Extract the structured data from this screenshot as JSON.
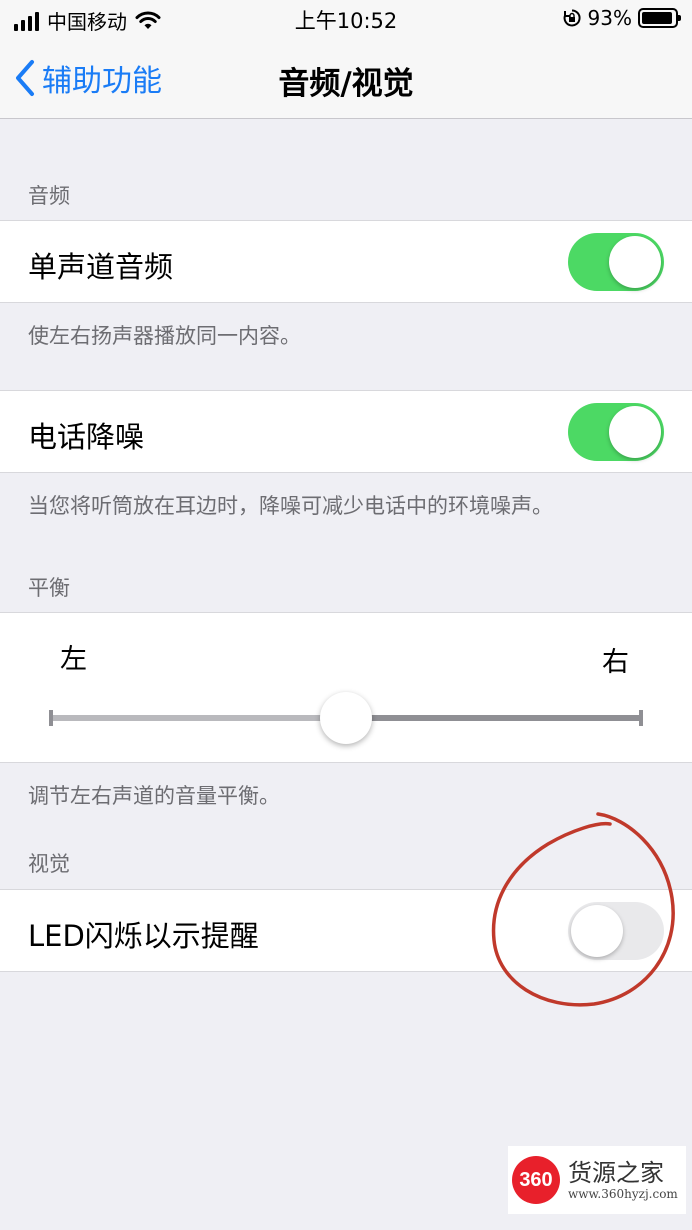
{
  "status_bar": {
    "carrier": "中国移动",
    "time": "上午10:52",
    "battery_percent_text": "93%",
    "battery_level": 0.93,
    "icons": [
      "signal-icon",
      "wifi-icon",
      "orientation-lock-icon",
      "battery-icon"
    ]
  },
  "nav": {
    "back_label": "辅助功能",
    "title": "音频/视觉",
    "accent_color": "#1a7cf6"
  },
  "sections": {
    "audio": {
      "header": "音频",
      "mono_audio": {
        "label": "单声道音频",
        "on": true
      },
      "mono_footer": "使左右扬声器播放同一内容。",
      "noise_cancel": {
        "label": "电话降噪",
        "on": true
      },
      "noise_footer": "当您将听筒放在耳边时，降噪可减少电话中的环境噪声。"
    },
    "balance": {
      "header": "平衡",
      "left_label": "左",
      "right_label": "右",
      "value": 0.5,
      "footer": "调节左右声道的音量平衡。"
    },
    "visual": {
      "header": "视觉",
      "led_flash": {
        "label": "LED闪烁以示提醒",
        "on": false
      }
    }
  },
  "colors": {
    "toggle_on": "#4cd964",
    "toggle_off": "#e9e9eb",
    "annotation_circle": "#c0392b"
  },
  "watermark": {
    "badge": "360",
    "title": "货源之家",
    "url": "www.360hyzj.com"
  }
}
